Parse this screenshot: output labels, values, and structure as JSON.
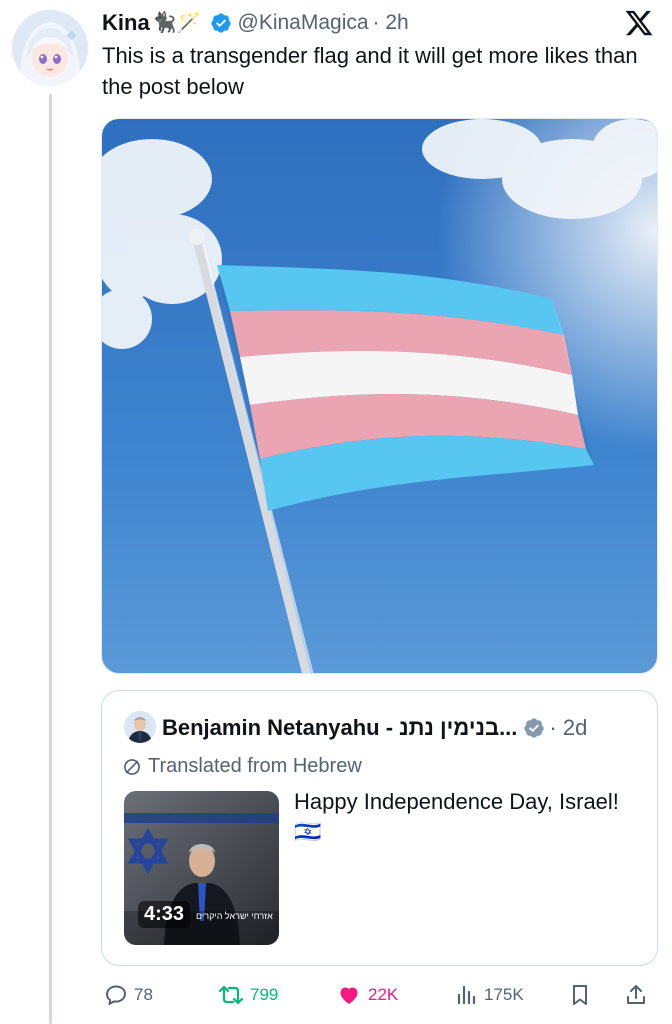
{
  "tweet": {
    "display_name": "Kina",
    "name_emojis": "🐈‍⬛🪄",
    "handle": "@KinaMagica",
    "time": "· 2h",
    "text": "This is a transgender flag and it will get more likes than the post below",
    "media_icon": "transgender-flag-photo"
  },
  "quote": {
    "display_name": "Benjamin Netanyahu - בנימין נתנ...",
    "date": "· 2d",
    "translated_label": "Translated from Hebrew",
    "text": "Happy Independence Day, Israel! 🇮🇱",
    "video_duration": "4:33",
    "video_caption": "אזרחי ישראל היקרים"
  },
  "actions": {
    "replies": "78",
    "retweets": "799",
    "likes": "22K",
    "views": "175K"
  },
  "colors": {
    "verified": "#1d9bf0",
    "retweet": "#00ba7c",
    "like": "#f91880",
    "muted": "#536471",
    "trans_blue": "#5bcffa",
    "trans_pink": "#f5abb9"
  }
}
